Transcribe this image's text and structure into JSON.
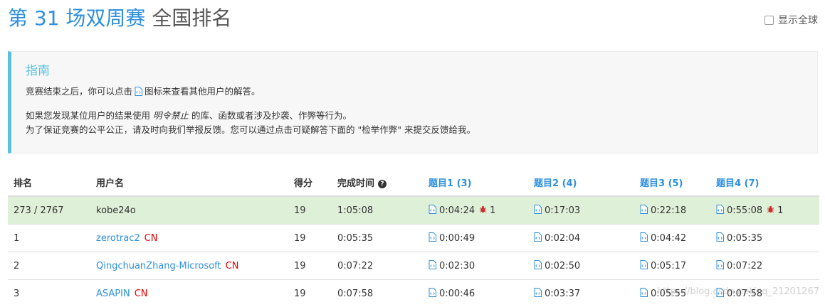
{
  "header": {
    "contest_title": "第 31 场双周赛",
    "rank_title": "全国排名",
    "global_toggle_label": "显示全球"
  },
  "guide": {
    "title": "指南",
    "line1_before": "竞赛结束之后，你可以点击",
    "line1_after": "图标来查看其他用户的解答。",
    "line2_before": "如果您发现某位用户的结果使用",
    "line2_em": "明令禁止",
    "line2_after": "的库、函数或者涉及抄袭、作弊等行为。",
    "line3": "为了保证竞赛的公平公正，请及时向我们举报反馈。您可以通过点击可疑解答下面的 \"检举作弊\" 来提交反馈给我。"
  },
  "table": {
    "headers": {
      "rank": "排名",
      "username": "用户名",
      "score": "得分",
      "finish_time": "完成时间",
      "q1": "题目1 (3)",
      "q2": "题目2 (4)",
      "q3": "题目3 (5)",
      "q4": "题目4 (7)"
    },
    "rows": [
      {
        "rank": "273 / 2767",
        "user": "kobe24o",
        "region": "",
        "score": "19",
        "finish": "1:05:08",
        "q1": "0:04:24",
        "q1_bug": "1",
        "q2": "0:17:03",
        "q2_bug": "",
        "q3": "0:22:18",
        "q3_bug": "",
        "q4": "0:55:08",
        "q4_bug": "1"
      },
      {
        "rank": "1",
        "user": "zerotrac2",
        "region": "CN",
        "score": "19",
        "finish": "0:05:35",
        "q1": "0:00:49",
        "q1_bug": "",
        "q2": "0:02:04",
        "q2_bug": "",
        "q3": "0:04:42",
        "q3_bug": "",
        "q4": "0:05:35",
        "q4_bug": ""
      },
      {
        "rank": "2",
        "user": "QingchuanZhang-Microsoft",
        "region": "CN",
        "score": "19",
        "finish": "0:07:22",
        "q1": "0:02:30",
        "q1_bug": "",
        "q2": "0:02:50",
        "q2_bug": "",
        "q3": "0:05:17",
        "q3_bug": "",
        "q4": "0:07:22",
        "q4_bug": ""
      },
      {
        "rank": "3",
        "user": "ASAPIN",
        "region": "CN",
        "score": "19",
        "finish": "0:07:58",
        "q1": "0:00:46",
        "q1_bug": "",
        "q2": "0:03:37",
        "q2_bug": "",
        "q3": "0:05:55",
        "q3_bug": "",
        "q4": "0:07:58",
        "q4_bug": ""
      }
    ]
  },
  "icons": {
    "code": "code-file-icon",
    "bug": "bug-icon",
    "help": "question-circle-icon"
  },
  "colors": {
    "accent": "#2d8fdd",
    "guide_accent": "#5bc0de",
    "highlight_row": "#dff0d8",
    "region": "#e00000",
    "bug": "#c9302c"
  },
  "watermark": "https://blog.csdn.net/qq_21201267"
}
